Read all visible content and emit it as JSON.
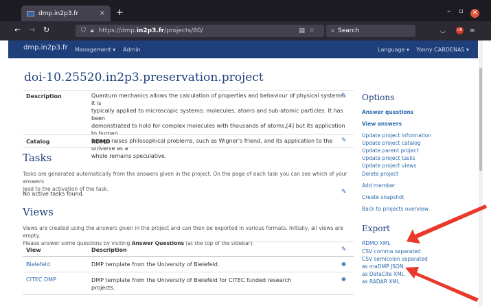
{
  "browser": {
    "tab_title": "dmp.in2p3.fr",
    "tab_close": "×",
    "new_tab": "+",
    "url_scheme": "https://dmp.",
    "url_host": "in2p3.fr",
    "url_path": "/projects/80/",
    "search_placeholder": "Search"
  },
  "site": {
    "brand": "dmp.in2p3.fr",
    "menu_management": "Management ▾",
    "menu_admin": "Admin",
    "menu_language": "Language ▾",
    "menu_user": "Yonny CARDENAS ▾"
  },
  "project": {
    "title": "doi-10.25520.in2p3.preservation.project",
    "description_label": "Description",
    "description_lines": [
      "Quantum mechanics allows the calculation of properties and behaviour of physical systems. It is",
      "typically applied to microscopic systems: molecules, atoms and sub-atomic particles. It has been",
      "demonstrated to hold for complex molecules with thousands of atoms,[4] but its application to human",
      "beings raises philosophical problems, such as Wigner's friend, and its application to the universe as a",
      "whole remains speculative."
    ],
    "catalog_label": "Catalog",
    "catalog_value": "RDMO"
  },
  "tasks": {
    "heading": "Tasks",
    "text_lines": [
      "Tasks are generated automatically from the answers given in the project. On the page of each task you can see which of your answers",
      "lead to the activation of the task."
    ],
    "empty": "No active tasks found."
  },
  "views": {
    "heading": "Views",
    "text_line1": "Views are created using the answers given in the project and can then be exported in various formats. Initially, all views are empty.",
    "text_line2_prefix": "Please answer some questions by visiting ",
    "text_line2_bold": "Answer Questions",
    "text_line2_suffix": " (at the top of the sidebar).",
    "col_view": "View",
    "col_description": "Description",
    "rows": [
      {
        "name": "Bielefeld",
        "description": [
          "DMP template from the University of Bielefeld."
        ]
      },
      {
        "name": "CITEC DMP",
        "description": [
          "DMP template from the University of Bielefeld for CITEC funded research",
          "projects."
        ]
      }
    ]
  },
  "sidebar": {
    "options_heading": "Options",
    "answer_questions": "Answer questions",
    "view_answers": "View answers",
    "links": [
      "Update project information",
      "Update project catalog",
      "Update parent project",
      "Update project tasks",
      "Update project views",
      "Delete project"
    ],
    "add_member": "Add member",
    "create_snapshot": "Create snapshot",
    "back": "Back to projects overview",
    "export_heading": "Export",
    "export_links": [
      "RDMO XML",
      "CSV comma separated",
      "CSV semicolon separated",
      "as maDMP JSON",
      "as DataCite XML",
      "as RADAR XML"
    ]
  },
  "colors": {
    "header": "#1e3f7a",
    "link": "#2b6aad",
    "arrow": "#e8392b"
  },
  "icons": [
    "pencil-icon",
    "eye-icon",
    "shield-icon",
    "lock-icon",
    "search-icon",
    "bookmark-star-icon",
    "reload-icon",
    "back-arrow-icon",
    "forward-arrow-icon"
  ]
}
